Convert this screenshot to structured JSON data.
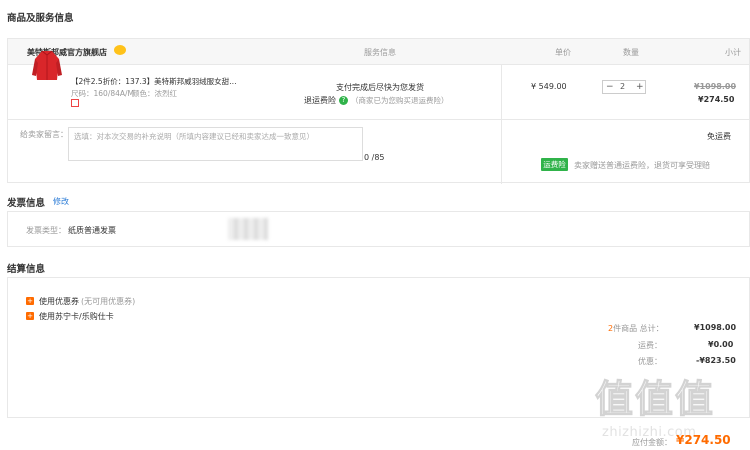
{
  "goods_section": {
    "title": "商品及服务信息"
  },
  "table": {
    "store_name": "美特斯邦威官方旗舰店",
    "col_service": "服务信息",
    "col_unit_price": "单价",
    "col_quantity": "数量",
    "col_subtotal": "小计"
  },
  "product": {
    "title": "【2件2.5折价：137.3】美特斯邦威羽绒服女甜…",
    "spec_size": "尺码：160/84A/M",
    "spec_color": "颜色：浓烈红",
    "service_line1": "支付完成后尽快为您发货",
    "service_return_label": "退运费险",
    "service_return_note": "（商家已为您购买退运费险）",
    "unit_price": "¥ 549.00",
    "quantity": "2",
    "minus": "−",
    "plus": "+",
    "original_subtotal": "¥1098.00",
    "subtotal": "¥274.50",
    "colors": {
      "jacket": "#d9262a"
    }
  },
  "message": {
    "label": "给卖家留言：",
    "placeholder": "选填：对本次交易的补充说明（所填内容建议已经和卖家达成一致意见）",
    "counter": "0 /85",
    "shipping": "免运费",
    "tag": "运费险",
    "tag_note": "卖家赠送普通运费险，退货可享受理赔"
  },
  "invoice": {
    "title": "发票信息",
    "edit": "修改",
    "type_label": "发票类型：",
    "type_value": "纸质普通发票"
  },
  "settle": {
    "title": "结算信息",
    "coupon_label": "使用优惠券",
    "coupon_note": "(无可用优惠券)",
    "card_label": "使用苏宁卡/乐购仕卡",
    "count_prefix": "2",
    "count_suffix": "件商品 总计：",
    "total": "¥1098.00",
    "freight_label": "运费：",
    "freight": "¥0.00",
    "discount_label": "优惠：",
    "discount": "-¥823.50",
    "payable_label": "应付金额：",
    "payable": "¥274.50"
  },
  "watermark": {
    "brand": "值值值",
    "url": "zhizhizhi.com"
  },
  "colors": {
    "accent": "#ff6b00",
    "green": "#30b34a",
    "link": "#2a7bd6"
  }
}
